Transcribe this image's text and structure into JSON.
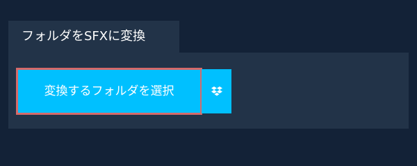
{
  "tab": {
    "label": "フォルダをSFXに変換"
  },
  "actions": {
    "select_folder_label": "変換するフォルダを選択",
    "dropbox_icon": "dropbox-icon"
  },
  "colors": {
    "background": "#132237",
    "panel": "#223348",
    "accent": "#00c0ff",
    "highlight_border": "#d66a6a",
    "text": "#ffffff"
  }
}
